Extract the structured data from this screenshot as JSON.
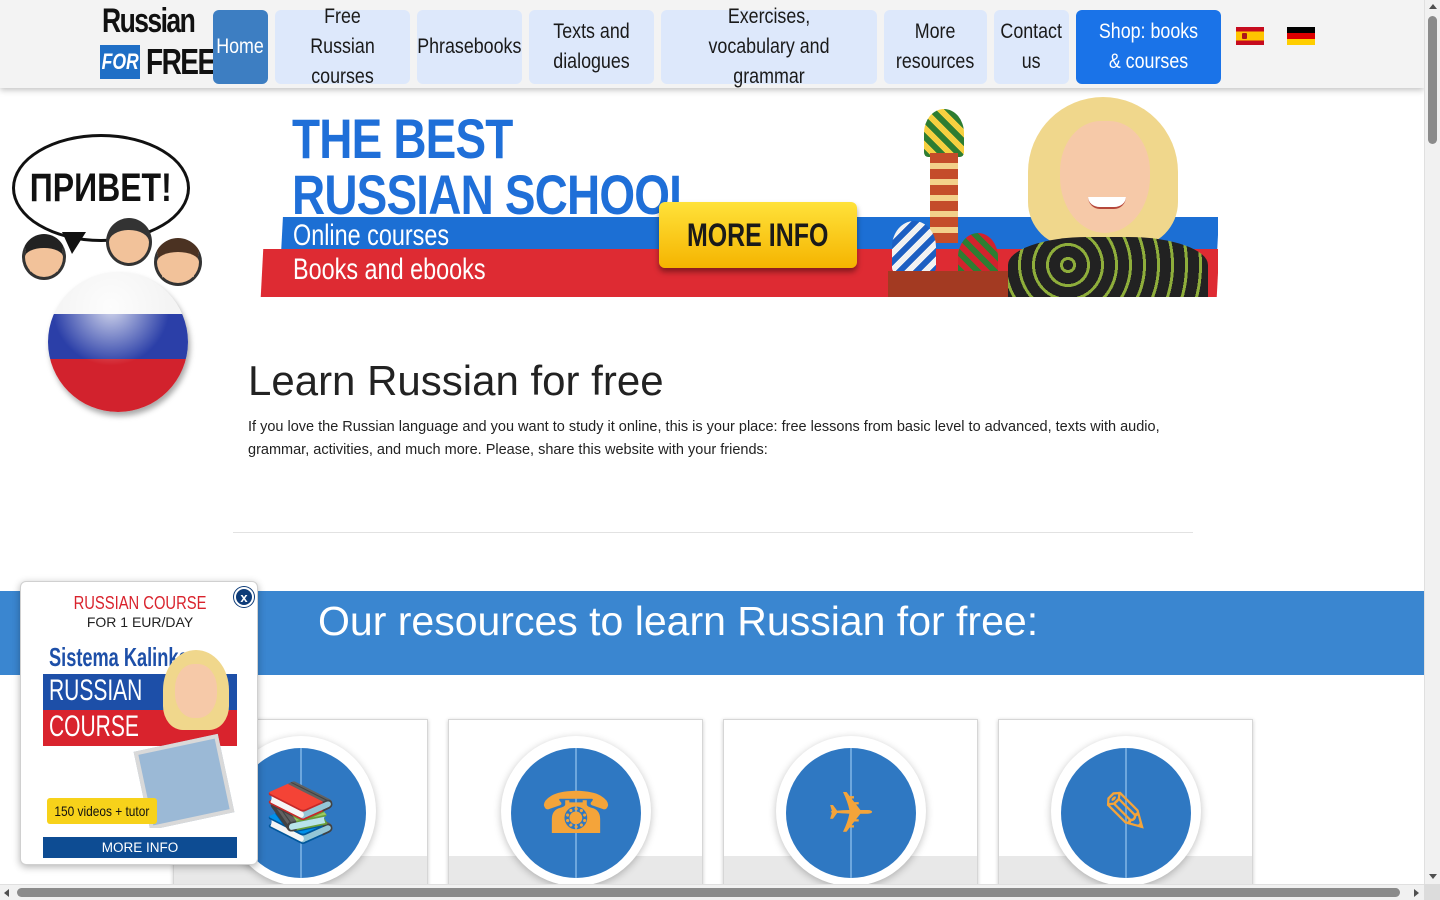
{
  "logo": {
    "line1": "Russian",
    "for": "FOR",
    "free": "FREE"
  },
  "nav": {
    "items": [
      {
        "label": "Home",
        "state": "active"
      },
      {
        "label": "Free Russian courses"
      },
      {
        "label": "Phrasebooks"
      },
      {
        "label": "Texts and dialogues"
      },
      {
        "label": "Exercises, vocabulary and grammar"
      },
      {
        "label": "More resources"
      },
      {
        "label": "Contact us"
      },
      {
        "label": "Shop: books & courses",
        "state": "highlight"
      }
    ],
    "flags": [
      {
        "icon": "flag-spain-icon",
        "language": "Spanish"
      },
      {
        "icon": "flag-germany-icon",
        "language": "German"
      }
    ]
  },
  "mascot": {
    "bubble_text": "ПРИВЕТ!"
  },
  "banner": {
    "title_line1": "THE BEST",
    "title_line2": "RUSSIAN SCHOOL",
    "sub1": "Online courses",
    "sub2": "Books and ebooks",
    "button": "MORE INFO"
  },
  "main": {
    "title": "Learn Russian for free",
    "intro": "If you love the Russian language and you want to study it online, this is your place: free lessons from basic level to advanced, texts with audio, grammar, activities, and much more. Please, share this website with your friends:"
  },
  "resources": {
    "heading": "Our resources to learn Russian for free:",
    "cards": [
      {
        "icon": "books-icon"
      },
      {
        "icon": "phone-and-book-icon"
      },
      {
        "icon": "airplane-and-toys-icon"
      },
      {
        "icon": "magnifier-and-pencil-icon"
      }
    ]
  },
  "popup": {
    "close": "x",
    "title": "RUSSIAN COURSE",
    "subtitle": "FOR 1 EUR/DAY",
    "cover_series": "Sistema Kalinka",
    "cover_line1": "RUSSIAN",
    "cover_line2": "COURSE",
    "badge": "150 videos + tutor",
    "button": "MORE INFO"
  },
  "colors": {
    "nav_bg": "#dde8fb",
    "nav_active": "#3d7ec2",
    "shop": "#1a73e8",
    "resources_bar": "#3a86d0",
    "banner_blue": "#1f6fd8",
    "banner_red": "#de2b33",
    "popup_button": "#0d4c93"
  }
}
